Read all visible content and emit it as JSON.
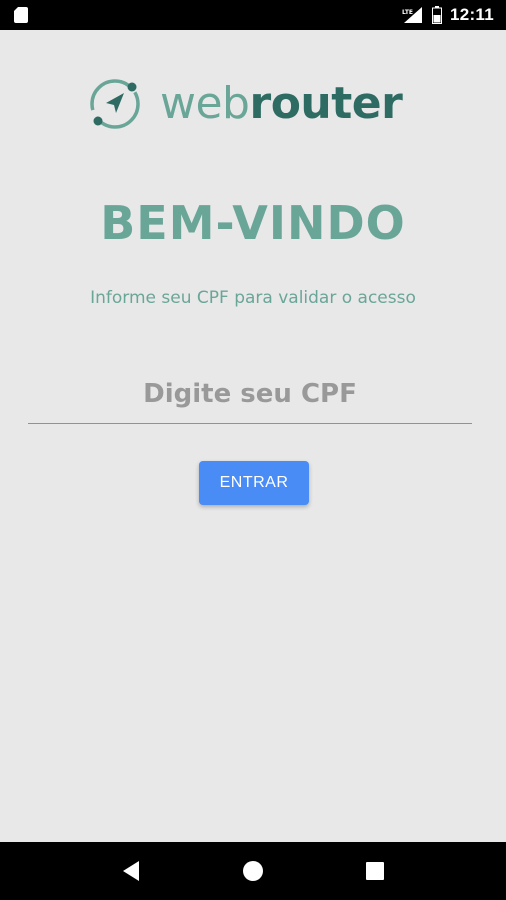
{
  "status_bar": {
    "time": "12:11",
    "icons": [
      "sd-card-icon",
      "lte-signal-icon",
      "battery-icon"
    ]
  },
  "logo": {
    "text_light": "web",
    "text_bold": "router",
    "icon": "navigation-arrow-icon"
  },
  "welcome": {
    "title": "BEM-VINDO",
    "subtitle": "Informe seu CPF para validar o acesso"
  },
  "form": {
    "cpf_placeholder": "Digite seu CPF",
    "cpf_value": "",
    "submit_label": "ENTRAR"
  },
  "nav_bar": {
    "buttons": [
      "back-icon",
      "home-icon",
      "recents-icon"
    ]
  },
  "colors": {
    "brand_light": "#6aa698",
    "brand_dark": "#2e6b63",
    "button": "#4a8cf6",
    "background": "#e8e8e8"
  }
}
